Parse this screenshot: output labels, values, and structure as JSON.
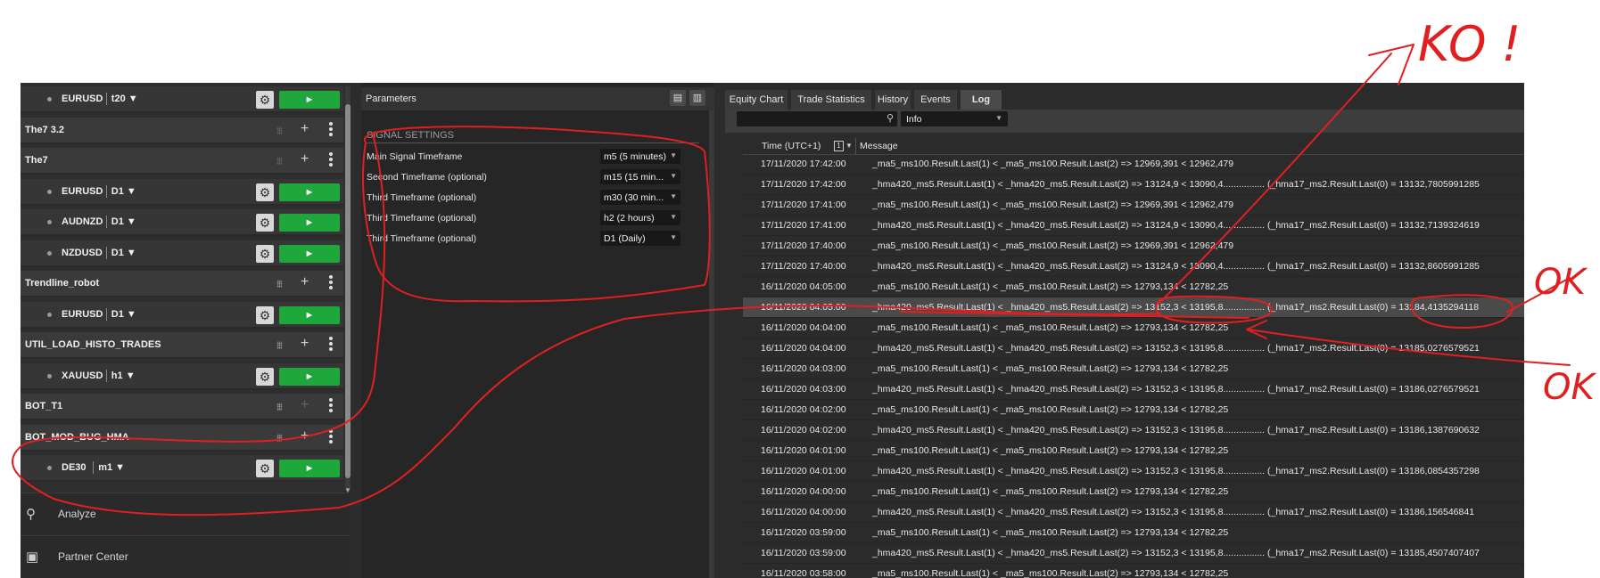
{
  "robots": {
    "rows": [
      {
        "type": "instance",
        "name": "EURUSD",
        "tf": "t20"
      },
      {
        "type": "group",
        "name": "The7 3.2"
      },
      {
        "type": "group",
        "name": "The7"
      },
      {
        "type": "instance",
        "name": "EURUSD",
        "tf": "D1"
      },
      {
        "type": "instance",
        "name": "AUDNZD",
        "tf": "D1"
      },
      {
        "type": "instance",
        "name": "NZDUSD",
        "tf": "D1"
      },
      {
        "type": "group",
        "name": "Trendline_robot"
      },
      {
        "type": "instance",
        "name": "EURUSD",
        "tf": "D1"
      },
      {
        "type": "group",
        "name": "UTIL_LOAD_HISTO_TRADES"
      },
      {
        "type": "instance",
        "name": "XAUUSD",
        "tf": "h1"
      },
      {
        "type": "group",
        "name": "BOT_T1"
      },
      {
        "type": "group",
        "name": "BOT_MOD_BUG_HMA"
      },
      {
        "type": "instance",
        "name": "DE30",
        "tf": "m1"
      }
    ],
    "dropdown_glyph": "▼",
    "play_glyph": "►",
    "gear_glyph": "⚙",
    "add_glyph": "+"
  },
  "nav": {
    "analyze": {
      "label": "Analyze",
      "icon": "analyze-icon"
    },
    "partner": {
      "label": "Partner Center",
      "icon": "briefcase-icon"
    }
  },
  "parameters": {
    "title": "Parameters",
    "section": "SIGNAL SETTINGS",
    "rows": [
      {
        "label": "Main Signal Timeframe",
        "value": "m5 (5 minutes)"
      },
      {
        "label": "Second Timeframe (optional)",
        "value": "m15 (15 min..."
      },
      {
        "label": "Third Timeframe (optional)",
        "value": "m30 (30 min..."
      },
      {
        "label": "Third Timeframe (optional)",
        "value": "h2 (2 hours)"
      },
      {
        "label": "Third Timeframe (optional)",
        "value": "D1 (Daily)"
      }
    ]
  },
  "tabs": [
    "Equity Chart",
    "Trade Statistics",
    "History",
    "Events",
    "Log"
  ],
  "active_tab": "Log",
  "log": {
    "filter_level": "Info",
    "col_time": "Time (UTC+1)",
    "col_message": "Message",
    "sort_badge": "1",
    "rows": [
      {
        "time": "17/11/2020 17:42:00",
        "message": "_ma5_ms100.Result.Last(1) < _ma5_ms100.Result.Last(2)  => 12969,391 < 12962,479"
      },
      {
        "time": "17/11/2020 17:42:00",
        "message": "_hma420_ms5.Result.Last(1) < _hma420_ms5.Result.Last(2)  => 13124,9 < 13090,4................ (_hma17_ms2.Result.Last(0) = 13132,7805991285"
      },
      {
        "time": "17/11/2020 17:41:00",
        "message": "_ma5_ms100.Result.Last(1) < _ma5_ms100.Result.Last(2)  => 12969,391 < 12962,479"
      },
      {
        "time": "17/11/2020 17:41:00",
        "message": "_hma420_ms5.Result.Last(1) < _hma420_ms5.Result.Last(2)  => 13124,9 < 13090,4................ (_hma17_ms2.Result.Last(0) = 13132,7139324619"
      },
      {
        "time": "17/11/2020 17:40:00",
        "message": "_ma5_ms100.Result.Last(1) < _ma5_ms100.Result.Last(2)  => 12969,391 < 12962,479"
      },
      {
        "time": "17/11/2020 17:40:00",
        "message": "_hma420_ms5.Result.Last(1) < _hma420_ms5.Result.Last(2)  => 13124,9 < 13090,4................ (_hma17_ms2.Result.Last(0) = 13132,8605991285"
      },
      {
        "time": "16/11/2020 04:05:00",
        "message": "_ma5_ms100.Result.Last(1) < _ma5_ms100.Result.Last(2)  => 12793,134 < 12782,25"
      },
      {
        "time": "16/11/2020 04:05:00",
        "message": "_hma420_ms5.Result.Last(1) < _hma420_ms5.Result.Last(2)  => 13152,3 < 13195,8................ (_hma17_ms2.Result.Last(0) = 13184,4135294118"
      },
      {
        "time": "16/11/2020 04:04:00",
        "message": "_ma5_ms100.Result.Last(1) < _ma5_ms100.Result.Last(2)  => 12793,134 < 12782,25"
      },
      {
        "time": "16/11/2020 04:04:00",
        "message": "_hma420_ms5.Result.Last(1) < _hma420_ms5.Result.Last(2)  => 13152,3 < 13195,8................ (_hma17_ms2.Result.Last(0) = 13185,0276579521"
      },
      {
        "time": "16/11/2020 04:03:00",
        "message": "_ma5_ms100.Result.Last(1) < _ma5_ms100.Result.Last(2)  => 12793,134 < 12782,25"
      },
      {
        "time": "16/11/2020 04:03:00",
        "message": "_hma420_ms5.Result.Last(1) < _hma420_ms5.Result.Last(2)  => 13152,3 < 13195,8................ (_hma17_ms2.Result.Last(0) = 13186,0276579521"
      },
      {
        "time": "16/11/2020 04:02:00",
        "message": "_ma5_ms100.Result.Last(1) < _ma5_ms100.Result.Last(2)  => 12793,134 < 12782,25"
      },
      {
        "time": "16/11/2020 04:02:00",
        "message": "_hma420_ms5.Result.Last(1) < _hma420_ms5.Result.Last(2)  => 13152,3 < 13195,8................ (_hma17_ms2.Result.Last(0) = 13186,1387690632"
      },
      {
        "time": "16/11/2020 04:01:00",
        "message": "_ma5_ms100.Result.Last(1) < _ma5_ms100.Result.Last(2)  => 12793,134 < 12782,25"
      },
      {
        "time": "16/11/2020 04:01:00",
        "message": "_hma420_ms5.Result.Last(1) < _hma420_ms5.Result.Last(2)  => 13152,3 < 13195,8................ (_hma17_ms2.Result.Last(0) = 13186,0854357298"
      },
      {
        "time": "16/11/2020 04:00:00",
        "message": "_ma5_ms100.Result.Last(1) < _ma5_ms100.Result.Last(2)  => 12793,134 < 12782,25"
      },
      {
        "time": "16/11/2020 04:00:00",
        "message": "_hma420_ms5.Result.Last(1) < _hma420_ms5.Result.Last(2)  => 13152,3 < 13195,8................ (_hma17_ms2.Result.Last(0) = 13186,156546841"
      },
      {
        "time": "16/11/2020 03:59:00",
        "message": "_ma5_ms100.Result.Last(1) < _ma5_ms100.Result.Last(2)  => 12793,134 < 12782,25"
      },
      {
        "time": "16/11/2020 03:59:00",
        "message": "_hma420_ms5.Result.Last(1) < _hma420_ms5.Result.Last(2)  => 13152,3 < 13195,8................ (_hma17_ms2.Result.Last(0) = 13185,4507407407"
      },
      {
        "time": "16/11/2020 03:58:00",
        "message": "_ma5_ms100.Result.Last(1) < _ma5_ms100.Result.Last(2)  => 12793,134 < 12782,25"
      }
    ],
    "selected_row": 7
  },
  "annotations": {
    "top_note": "KO !",
    "right_note_1": "OK",
    "right_note_2": "OK",
    "ink_color": "#e02020"
  }
}
